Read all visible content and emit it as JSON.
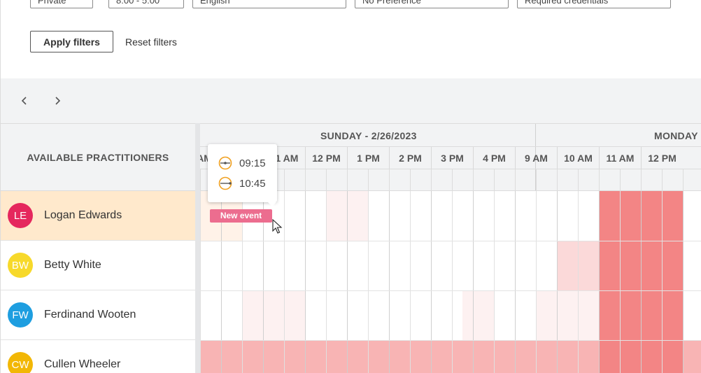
{
  "filters": {
    "selects": [
      "Private",
      "8:00 - 5:00",
      "English",
      "No Preference",
      "Required credentials"
    ],
    "apply_label": "Apply filters",
    "reset_label": "Reset filters"
  },
  "nav": {
    "prev_icon": "chevron-left-icon",
    "next_icon": "chevron-right-icon"
  },
  "scheduler": {
    "resource_header": "AVAILABLE PRACTITIONERS",
    "days": [
      {
        "label": "SUNDAY - 2/26/2023"
      },
      {
        "label": "MONDAY"
      }
    ],
    "hours": [
      "9 AM",
      "10 AM",
      "11 AM",
      "12 PM",
      "1 PM",
      "2 PM",
      "3 PM",
      "4 PM",
      "9 AM",
      "10 AM",
      "11 AM",
      "12 PM"
    ],
    "practitioners": [
      {
        "initials": "LE",
        "name": "Logan Edwards",
        "color": "#e5275d",
        "highlighted": true
      },
      {
        "initials": "BW",
        "name": "Betty White",
        "color": "#f7d92b",
        "highlighted": false
      },
      {
        "initials": "FW",
        "name": "Ferdinand Wooten",
        "color": "#1e9ee0",
        "highlighted": false
      },
      {
        "initials": "CW",
        "name": "Cullen Wheeler",
        "color": "#f2b705",
        "highlighted": false
      }
    ],
    "new_event_label": "New event",
    "tooltip": {
      "start": "09:15",
      "end": "10:45"
    }
  },
  "colors": {
    "availability_strong": "#f38585",
    "availability_medium": "#f8b4b4",
    "availability_light": "#fbd9d9",
    "availability_faint": "#fdf1f1",
    "event": "#ec6d8f",
    "tooltip_icon": "#f0a020"
  }
}
